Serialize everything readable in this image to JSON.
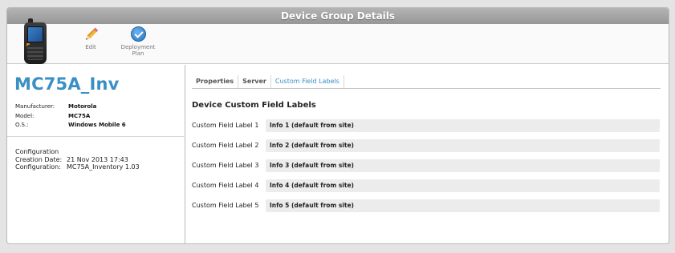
{
  "window": {
    "title": "Device Group Details"
  },
  "toolbar": {
    "edit_label": "Edit",
    "deploy_label_line1": "Deployment",
    "deploy_label_line2": "Plan"
  },
  "device": {
    "name": "MC75A_Inv",
    "properties": [
      {
        "key": "Manufacturer:",
        "value": "Motorola"
      },
      {
        "key": "Model:",
        "value": "MC75A"
      },
      {
        "key": "O.S.:",
        "value": "Windows Mobile 6"
      }
    ],
    "configuration": {
      "heading": "Configuration",
      "rows": [
        {
          "key": "Creation Date:",
          "value": "21 Nov 2013 17:43"
        },
        {
          "key": "Configuration:",
          "value": "MC75A_Inventory 1.03"
        }
      ]
    }
  },
  "tabs": [
    {
      "label": "Properties",
      "active": false
    },
    {
      "label": "Server",
      "active": false
    },
    {
      "label": "Custom Field Labels",
      "active": true
    }
  ],
  "section": {
    "title": "Device Custom Field Labels"
  },
  "fields": [
    {
      "label": "Custom Field Label 1",
      "value": "Info 1 (default from site)"
    },
    {
      "label": "Custom Field Label 2",
      "value": "Info 2 (default from site)"
    },
    {
      "label": "Custom Field Label 3",
      "value": "Info 3 (default from site)"
    },
    {
      "label": "Custom Field Label 4",
      "value": "Info 4 (default from site)"
    },
    {
      "label": "Custom Field Label 5",
      "value": "Info 5 (default from site)"
    }
  ],
  "colors": {
    "accent": "#3a8fc4",
    "title_bar": "#a6a6a6",
    "field_bg": "#ececec"
  }
}
